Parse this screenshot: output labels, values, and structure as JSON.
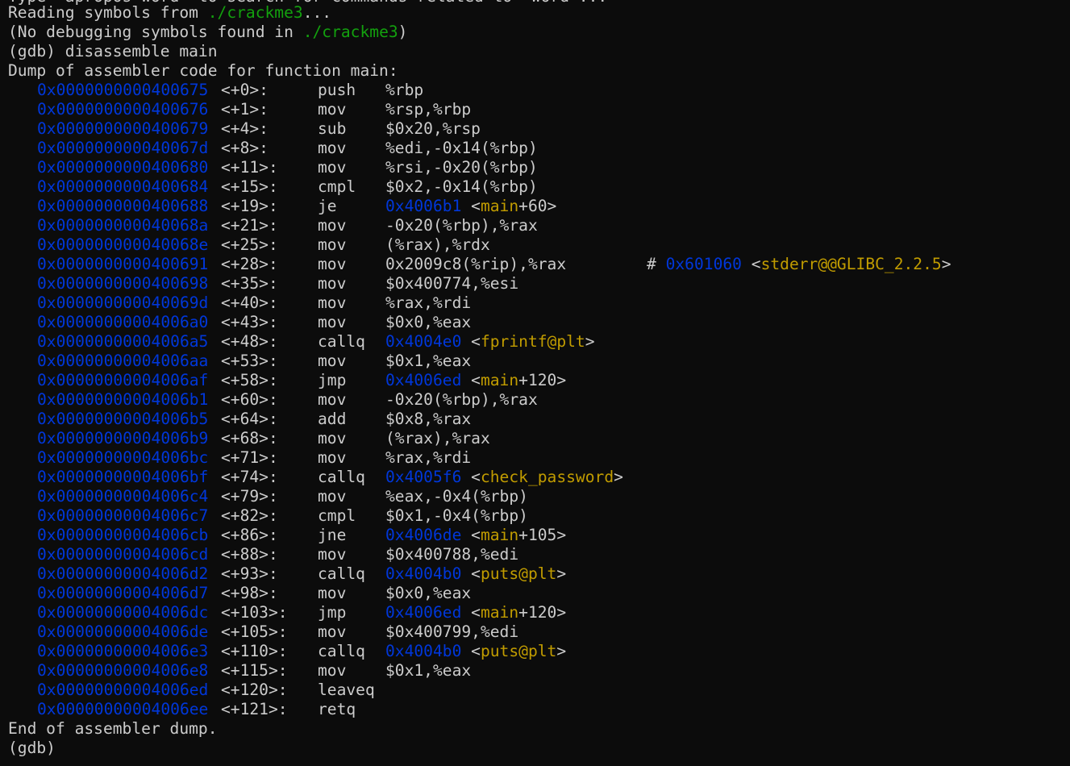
{
  "top_partial": "Type \"apropos word\" to search for commands related to \"word\"...",
  "header_lines": [
    {
      "pre": "Reading symbols from ",
      "file": "./crackme3",
      "post": "..."
    },
    {
      "pre": "(No debugging symbols found in ",
      "file": "./crackme3",
      "post": ")"
    }
  ],
  "command": "(gdb) disassemble main",
  "dump_header": "Dump of assembler code for function main:",
  "instructions": [
    {
      "addr": "0x0000000000400675",
      "off": "<+0>:",
      "mnem": "push",
      "ops": "%rbp"
    },
    {
      "addr": "0x0000000000400676",
      "off": "<+1>:",
      "mnem": "mov",
      "ops": "%rsp,%rbp"
    },
    {
      "addr": "0x0000000000400679",
      "off": "<+4>:",
      "mnem": "sub",
      "ops": "$0x20,%rsp"
    },
    {
      "addr": "0x000000000040067d",
      "off": "<+8>:",
      "mnem": "mov",
      "ops": "%edi,-0x14(%rbp)"
    },
    {
      "addr": "0x0000000000400680",
      "off": "<+11>:",
      "mnem": "mov",
      "ops": "%rsi,-0x20(%rbp)"
    },
    {
      "addr": "0x0000000000400684",
      "off": "<+15>:",
      "mnem": "cmpl",
      "ops": "$0x2,-0x14(%rbp)"
    },
    {
      "addr": "0x0000000000400688",
      "off": "<+19>:",
      "mnem": "je",
      "target": "0x4006b1",
      "sym": "main",
      "symoff": "+60"
    },
    {
      "addr": "0x000000000040068a",
      "off": "<+21>:",
      "mnem": "mov",
      "ops": "-0x20(%rbp),%rax"
    },
    {
      "addr": "0x000000000040068e",
      "off": "<+25>:",
      "mnem": "mov",
      "ops": "(%rax),%rdx"
    },
    {
      "addr": "0x0000000000400691",
      "off": "<+28>:",
      "mnem": "mov",
      "ops": "0x2009c8(%rip),%rax",
      "comment_addr": "0x601060",
      "comment_sym": "stderr@@GLIBC_2.2.5"
    },
    {
      "addr": "0x0000000000400698",
      "off": "<+35>:",
      "mnem": "mov",
      "ops": "$0x400774,%esi"
    },
    {
      "addr": "0x000000000040069d",
      "off": "<+40>:",
      "mnem": "mov",
      "ops": "%rax,%rdi"
    },
    {
      "addr": "0x00000000004006a0",
      "off": "<+43>:",
      "mnem": "mov",
      "ops": "$0x0,%eax"
    },
    {
      "addr": "0x00000000004006a5",
      "off": "<+48>:",
      "mnem": "callq",
      "target": "0x4004e0",
      "sym": "fprintf@plt",
      "symoff": ""
    },
    {
      "addr": "0x00000000004006aa",
      "off": "<+53>:",
      "mnem": "mov",
      "ops": "$0x1,%eax"
    },
    {
      "addr": "0x00000000004006af",
      "off": "<+58>:",
      "mnem": "jmp",
      "target": "0x4006ed",
      "sym": "main",
      "symoff": "+120"
    },
    {
      "addr": "0x00000000004006b1",
      "off": "<+60>:",
      "mnem": "mov",
      "ops": "-0x20(%rbp),%rax"
    },
    {
      "addr": "0x00000000004006b5",
      "off": "<+64>:",
      "mnem": "add",
      "ops": "$0x8,%rax"
    },
    {
      "addr": "0x00000000004006b9",
      "off": "<+68>:",
      "mnem": "mov",
      "ops": "(%rax),%rax"
    },
    {
      "addr": "0x00000000004006bc",
      "off": "<+71>:",
      "mnem": "mov",
      "ops": "%rax,%rdi"
    },
    {
      "addr": "0x00000000004006bf",
      "off": "<+74>:",
      "mnem": "callq",
      "target": "0x4005f6",
      "sym": "check_password",
      "symoff": ""
    },
    {
      "addr": "0x00000000004006c4",
      "off": "<+79>:",
      "mnem": "mov",
      "ops": "%eax,-0x4(%rbp)"
    },
    {
      "addr": "0x00000000004006c7",
      "off": "<+82>:",
      "mnem": "cmpl",
      "ops": "$0x1,-0x4(%rbp)"
    },
    {
      "addr": "0x00000000004006cb",
      "off": "<+86>:",
      "mnem": "jne",
      "target": "0x4006de",
      "sym": "main",
      "symoff": "+105"
    },
    {
      "addr": "0x00000000004006cd",
      "off": "<+88>:",
      "mnem": "mov",
      "ops": "$0x400788,%edi"
    },
    {
      "addr": "0x00000000004006d2",
      "off": "<+93>:",
      "mnem": "callq",
      "target": "0x4004b0",
      "sym": "puts@plt",
      "symoff": ""
    },
    {
      "addr": "0x00000000004006d7",
      "off": "<+98>:",
      "mnem": "mov",
      "ops": "$0x0,%eax"
    },
    {
      "addr": "0x00000000004006dc",
      "off": "<+103>:",
      "mnem": "jmp",
      "target": "0x4006ed",
      "sym": "main",
      "symoff": "+120"
    },
    {
      "addr": "0x00000000004006de",
      "off": "<+105>:",
      "mnem": "mov",
      "ops": "$0x400799,%edi"
    },
    {
      "addr": "0x00000000004006e3",
      "off": "<+110>:",
      "mnem": "callq",
      "target": "0x4004b0",
      "sym": "puts@plt",
      "symoff": ""
    },
    {
      "addr": "0x00000000004006e8",
      "off": "<+115>:",
      "mnem": "mov",
      "ops": "$0x1,%eax"
    },
    {
      "addr": "0x00000000004006ed",
      "off": "<+120>:",
      "mnem": "leaveq",
      "ops": ""
    },
    {
      "addr": "0x00000000004006ee",
      "off": "<+121>:",
      "mnem": "retq",
      "ops": ""
    }
  ],
  "dump_footer": "End of assembler dump.",
  "prompt": "(gdb) ",
  "colors": {
    "background": "#0c0c0c",
    "foreground": "#cccccc",
    "path": "#13a10e",
    "address": "#0037da",
    "symbol": "#c19c00"
  }
}
